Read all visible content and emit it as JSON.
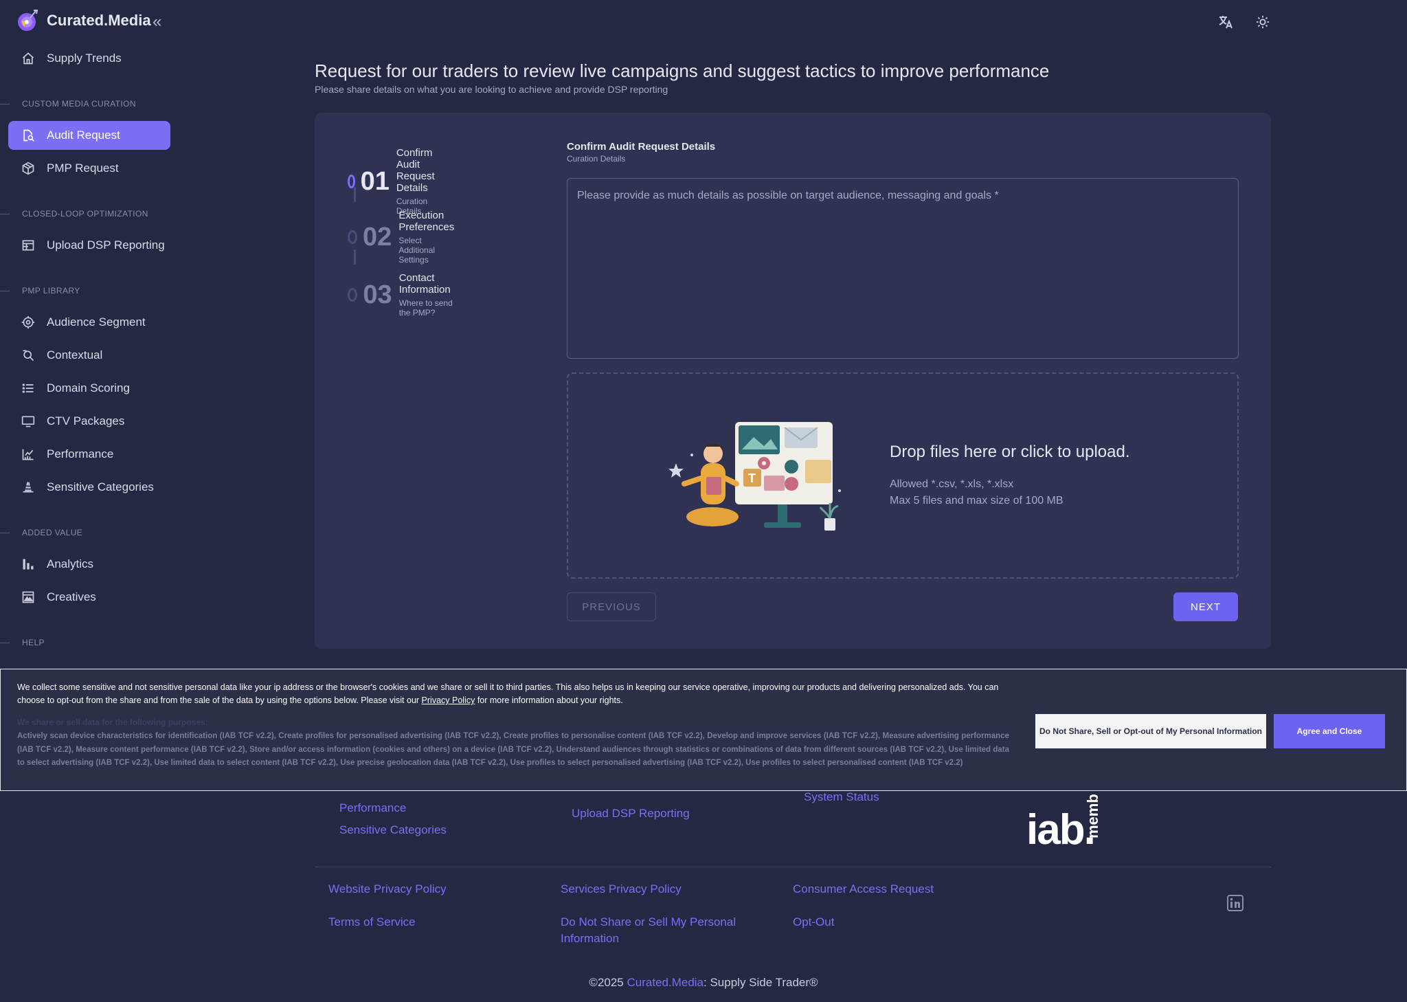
{
  "brand": {
    "name": "Curated.Media"
  },
  "sidebar": {
    "top_item": {
      "label": "Supply Trends",
      "icon": "home-icon"
    },
    "sections": [
      {
        "title": "CUSTOM MEDIA CURATION"
      },
      {
        "title": "CLOSED-LOOP OPTIMIZATION"
      },
      {
        "title": "PMP LIBRARY"
      },
      {
        "title": "ADDED VALUE"
      },
      {
        "title": "HELP"
      }
    ],
    "items": [
      {
        "label": "Audit Request",
        "icon": "audit-search-icon",
        "active": true
      },
      {
        "label": "PMP Request",
        "icon": "package-icon"
      },
      {
        "label": "Upload DSP Reporting",
        "icon": "table-icon"
      },
      {
        "label": "Audience Segment",
        "icon": "target-icon"
      },
      {
        "label": "Contextual",
        "icon": "search-icon"
      },
      {
        "label": "Domain Scoring",
        "icon": "list-icon"
      },
      {
        "label": "CTV Packages",
        "icon": "tv-icon"
      },
      {
        "label": "Performance",
        "icon": "chart-line-icon"
      },
      {
        "label": "Sensitive Categories",
        "icon": "cone-icon"
      },
      {
        "label": "Analytics",
        "icon": "bar-chart-icon"
      },
      {
        "label": "Creatives",
        "icon": "image-icon"
      }
    ]
  },
  "header": {
    "title": "Request for our traders to review live campaigns and suggest tactics to improve performance",
    "subtitle": "Please share details on what you are looking to achieve and provide DSP reporting"
  },
  "stepper": {
    "steps": [
      {
        "num": "01",
        "title": "Confirm Audit Request Details",
        "sub": "Curation Details",
        "active": true
      },
      {
        "num": "02",
        "title": "Execution Preferences",
        "sub": "Select Additional Settings"
      },
      {
        "num": "03",
        "title": "Contact Information",
        "sub": "Where to send the PMP?"
      }
    ]
  },
  "form": {
    "title": "Confirm Audit Request Details",
    "subtitle": "Curation Details",
    "textarea_placeholder": "Please provide as much details as possible on target audience, messaging and goals *",
    "dropzone": {
      "title": "Drop files here or click to upload.",
      "allowed": "Allowed *.csv, *.xls, *.xlsx",
      "max": "Max 5 files and max size of 100 MB"
    },
    "prev_label": "PREVIOUS",
    "next_label": "NEXT"
  },
  "cookie": {
    "text_part1": "We collect some sensitive and not sensitive personal data like your ip address or the browser's cookies and we share or sell it to third parties. This also helps us in keeping our service operative, improving our products and delivering personalized ads. You can choose to opt-out from the share and from the sale of the data by using the options below. Please visit our ",
    "privacy_link": "Privacy Policy",
    "text_part2": " for more information about your rights.",
    "hidden_line": "We share or sell data for the following purposes:",
    "purposes": "Actively scan device characteristics for identification (IAB TCF v2.2), Create profiles for personalised advertising (IAB TCF v2.2), Create profiles to personalise content (IAB TCF v2.2), Develop and improve services (IAB TCF v2.2), Measure advertising performance (IAB TCF v2.2), Measure content performance (IAB TCF v2.2), Store and/or access information (cookies and others) on a device (IAB TCF v2.2), Understand audiences through statistics or combinations of data from different sources (IAB TCF v2.2), Use limited data to select advertising (IAB TCF v2.2), Use limited data to select content (IAB TCF v2.2), Use precise geolocation data (IAB TCF v2.2), Use profiles to select personalised advertising (IAB TCF v2.2), Use profiles to select personalised content (IAB TCF v2.2)",
    "optout_label": "Do Not Share, Sell or Opt-out of My Personal Information",
    "agree_label": "Agree and Close"
  },
  "footer": {
    "col1": [
      "Performance",
      "Sensitive Categories"
    ],
    "col2": [
      "Upload DSP Reporting"
    ],
    "col3": [
      "System Status"
    ],
    "iab_text": "iab.",
    "iab_vertical": "memb",
    "legal": {
      "website_privacy": "Website Privacy Policy",
      "services_privacy": "Services Privacy Policy",
      "consumer_access": "Consumer Access Request",
      "terms": "Terms of Service",
      "do_not_share_1": "Do Not Share or Sell My Personal",
      "do_not_share_2": "Information",
      "opt_out": "Opt-Out"
    },
    "copyright_pre": "©2025 ",
    "copyright_brand": "Curated.Media",
    "copyright_post": ": Supply Side Trader®"
  },
  "colors": {
    "accent": "#7b6ff3",
    "background": "#252842",
    "card": "#2f3252"
  }
}
